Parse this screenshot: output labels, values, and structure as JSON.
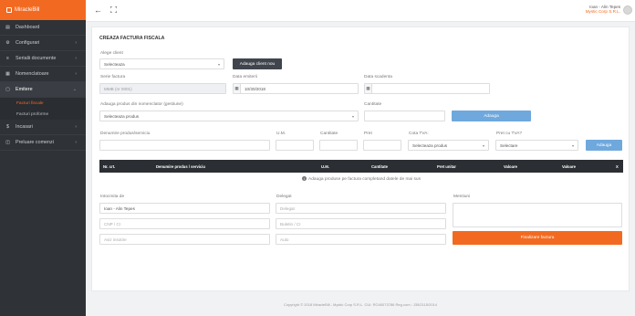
{
  "brand": {
    "name": "MiracleBill"
  },
  "sidebar": {
    "items": [
      {
        "label": "Dashboard",
        "icon": "dashboard-icon"
      },
      {
        "label": "Configurari",
        "icon": "gear-icon"
      },
      {
        "label": "Serialii documente",
        "icon": "list-icon"
      },
      {
        "label": "Nomenclatoare",
        "icon": "book-icon"
      },
      {
        "label": "Emitere",
        "icon": "file-icon"
      },
      {
        "label": "Incasari",
        "icon": "money-icon"
      },
      {
        "label": "Preluare comenzi",
        "icon": "cart-icon"
      }
    ],
    "sub_items": [
      {
        "label": "Facturi fiscale"
      },
      {
        "label": "Facturi proforme"
      }
    ]
  },
  "topbar": {
    "user_name": "Ioan - Alin Tepes",
    "company": "Mystic Corp S.R.L."
  },
  "form": {
    "title": "CREAZA FACTURA FISCALA",
    "client_label": "Alege client",
    "client_value": "Selecteaza",
    "add_client_label": "Adauga client nou",
    "serie_label": "Serie factura",
    "serie_value": "MMB (nr 0001)",
    "date_label": "Data emiterii",
    "date_value": "10/30/2018",
    "due_label": "Data scadenta",
    "nomen_label": "Adauga produs din nomenclator (gestiune)",
    "nomen_value": "Selecteaza produs",
    "qty_label": "Cantitate",
    "add_btn_label": "Adauga",
    "prod_name_label": "Denumire produs/serviciu",
    "um_label": "U.M.",
    "qty2_label": "Cantitate",
    "pret_label": "Pret",
    "tva_label": "Cota TVA:",
    "tva_value": "Selecteaza produs",
    "pret_tva_label": "Pret cu TVA?",
    "pret_tva_value": "Selectare",
    "add_btn2_label": "Adauga"
  },
  "table": {
    "headers": [
      "Nr. crt.",
      "Denumire produs / serviciu",
      "U.M.",
      "Cantitate",
      "Pret unitar",
      "Valoare",
      "Valoare",
      "X"
    ],
    "empty_message": "Adauga produse pe factura completand datele de mai sus"
  },
  "bottom": {
    "intocmita_label": "Intocmita de",
    "intocmita_value": "Ioan - Alin Tepes",
    "cnp_placeholder": "CNP / CI",
    "auto_placeholder": "Aviz insotire",
    "delegat_label": "Delegat",
    "delegat_placeholder": "Delegat",
    "buletin_placeholder": "Buletin / CI",
    "auto2_placeholder": "Auto",
    "mentiuni_label": "Mentiuni",
    "finalize_label": "Finalizare factura"
  },
  "footer": {
    "text": "Copyright © 2018 MiracleBill - Mystic Corp S.R.L. CUI: RO40073786 Reg.com.: J35/2115/2014"
  },
  "colors": {
    "accent": "#f26a21",
    "sidebar": "#2f3237",
    "blue_button": "#6fa8dc"
  }
}
